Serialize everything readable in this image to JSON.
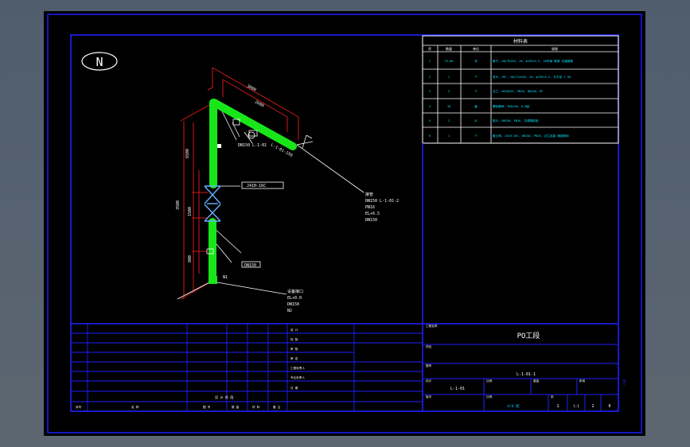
{
  "north_symbol": "N",
  "title_block": {
    "drawing_name": "PO工段",
    "drawing_code": "L-1-01-1",
    "sheet_total": "1",
    "sheet_no": "2",
    "sheet_count": "6",
    "scale_label": "1:1",
    "part_label": "L-1-01",
    "revision_label": "A/0 版"
  },
  "material_table": {
    "header": "材料表",
    "columns": [
      "序",
      "数量",
      "单位",
      "规格"
    ],
    "rows": [
      {
        "no": "1",
        "qty": "15.88",
        "unit": "米",
        "spec": "管子, GB/T8163, 20, φ159×4.5, 20号钢 碳钢 无缝钢管"
      },
      {
        "no": "2",
        "qty": "1",
        "unit": "个",
        "spec": "弯头, 90°, GB/T12459, 20, φ159×4.5, 长半径 1.5D"
      },
      {
        "no": "3",
        "qty": "2",
        "unit": "个",
        "spec": "法兰, HG20592, PN16, DN150, RF"
      },
      {
        "no": "4",
        "qty": "16",
        "unit": "套",
        "spec": "螺栓螺母, M20×90, 8.8级"
      },
      {
        "no": "5",
        "qty": "2",
        "unit": "片",
        "spec": "垫片, DN150, PN16, 石棉橡胶板"
      },
      {
        "no": "6",
        "qty": "1",
        "unit": "个",
        "spec": "截止阀, J41H-16C, DN150, PN16, 法兰连接 铸钢阀体"
      }
    ]
  },
  "callouts": {
    "top_pipe": "L-1-01-159",
    "upper_box": "DN150 L-1-01",
    "valve": "J41H-16C",
    "lower_box": "DN150",
    "nozzle_left": "N1",
    "right_block": [
      "接管",
      "DN150 L-1-01-2",
      "PN16",
      "EL+6.5",
      "DN150"
    ],
    "bottom_block": [
      "设备接口",
      "EL+0.0",
      "DN150",
      "N2"
    ],
    "dims_top": [
      "3000",
      "2600"
    ],
    "dims_left": [
      "6500",
      "3500",
      "1500",
      "800"
    ]
  },
  "lower_grid": {
    "rows": [
      "设 计",
      "校 核",
      "审 核",
      "审 定",
      "工程负责人",
      "专业负责人",
      "日 期"
    ],
    "footer": [
      "序号",
      "名 称",
      "图 号",
      "数 量",
      "材 料",
      "备 注"
    ],
    "mid_label": "设 计 阶 段",
    "labels": {
      "project": "工程名称",
      "item": "项目",
      "drawing_no_label": "图号",
      "scale": "比例",
      "weight": "重量",
      "sheet": "张",
      "rev": "版次",
      "design": "设计",
      "ratio": "比例",
      "stage": "阶段"
    }
  },
  "side_text": "CAD"
}
